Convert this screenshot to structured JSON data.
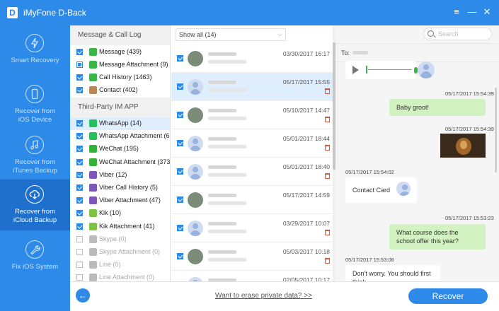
{
  "app": {
    "logo": "D",
    "title": "iMyFone D-Back"
  },
  "window_controls": {
    "menu": "≡",
    "minimize": "—",
    "close": "✕"
  },
  "sidebar": {
    "items": [
      {
        "line1": "Smart Recovery",
        "line2": "",
        "icon": "lightning-icon"
      },
      {
        "line1": "Recover from",
        "line2": "iOS Device",
        "icon": "phone-icon"
      },
      {
        "line1": "Recover from",
        "line2": "iTunes Backup",
        "icon": "music-icon"
      },
      {
        "line1": "Recover from",
        "line2": "iCloud Backup",
        "icon": "cloud-download-icon"
      },
      {
        "line1": "Fix iOS System",
        "line2": "",
        "icon": "wrench-icon"
      }
    ]
  },
  "categories": {
    "section1": "Message & Call Log",
    "section2": "Third-Party IM APP",
    "items": [
      {
        "label": "Message (439)",
        "color": "#3bb54a",
        "state": "on"
      },
      {
        "label": "Message Attachment (9)",
        "color": "#3bb54a",
        "state": "partial"
      },
      {
        "label": "Call History (1463)",
        "color": "#3bb54a",
        "state": "on"
      },
      {
        "label": "Contact (402)",
        "color": "#b9875a",
        "state": "on"
      },
      {
        "label": "WhatsApp (14)",
        "color": "#25c05a",
        "state": "on"
      },
      {
        "label": "WhatsApp Attachment (619)",
        "color": "#25c05a",
        "state": "on"
      },
      {
        "label": "WeChat (195)",
        "color": "#35b23c",
        "state": "on"
      },
      {
        "label": "WeChat Attachment (37368)",
        "color": "#35b23c",
        "state": "on"
      },
      {
        "label": "Viber (12)",
        "color": "#7d58b8",
        "state": "on"
      },
      {
        "label": "Viber Call History (5)",
        "color": "#7d58b8",
        "state": "on"
      },
      {
        "label": "Viber Attachment (47)",
        "color": "#7d58b8",
        "state": "on"
      },
      {
        "label": "Kik (10)",
        "color": "#7ec242",
        "state": "on"
      },
      {
        "label": "Kik Attachment (41)",
        "color": "#7ec242",
        "state": "on"
      },
      {
        "label": "Skype (0)",
        "color": "#bbbbbb",
        "state": "off"
      },
      {
        "label": "Skype Attachment (0)",
        "color": "#bbbbbb",
        "state": "off"
      },
      {
        "label": "Line (0)",
        "color": "#bbbbbb",
        "state": "off"
      },
      {
        "label": "Line Attachment (0)",
        "color": "#bbbbbb",
        "state": "off"
      }
    ]
  },
  "list": {
    "filter": "Show all (14)",
    "rows": [
      {
        "date": "03/30/2017 16:17",
        "deleted": false
      },
      {
        "date": "05/17/2017 15:55",
        "deleted": true
      },
      {
        "date": "05/10/2017 14:47",
        "deleted": true
      },
      {
        "date": "05/01/2017 18:44",
        "deleted": true
      },
      {
        "date": "05/01/2017 18:40",
        "deleted": true
      },
      {
        "date": "05/17/2017 14:59",
        "deleted": false
      },
      {
        "date": "03/29/2017 10:07",
        "deleted": true
      },
      {
        "date": "05/03/2017 10:18",
        "deleted": true
      },
      {
        "date": "02/05/2017 10:17",
        "deleted": true
      }
    ]
  },
  "conversation": {
    "search_placeholder": "Search",
    "to_label": "To:",
    "messages": {
      "ts1": "05/17/2017 15:54:39",
      "b1": "Baby groot!",
      "ts2": "05/17/2017 15:54:39",
      "ts3": "05/17/2017 15:54:02",
      "contact_card": "Contact Card",
      "ts4": "05/17/2017 15:53:23",
      "b2": "What course does the school offer this year?",
      "ts5": "05/17/2017 15:53:06",
      "b3": "Don't worry. You should first think"
    }
  },
  "bottom": {
    "back": "←",
    "erase_link": "Want to erase private data? >>",
    "recover": "Recover"
  },
  "colors": {
    "accent": "#2d8ae8",
    "sidebar_active": "#1f6fcd",
    "bubble_out": "#d2f2c2",
    "delete": "#e0523a"
  }
}
